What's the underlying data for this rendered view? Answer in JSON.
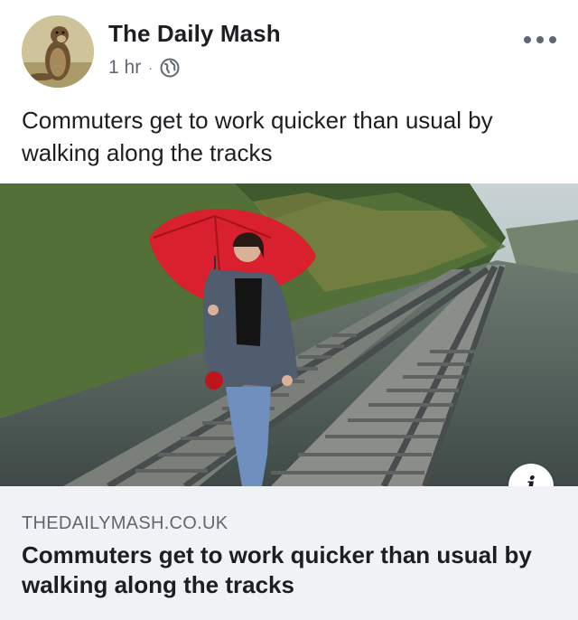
{
  "post": {
    "page_name": "The Daily Mash",
    "time": "1 hr",
    "separator": "·",
    "privacy_icon": "globe-icon",
    "menu_icon": "more-options-icon",
    "caption": "Commuters get to work quicker than usual by walking along the tracks"
  },
  "link_preview": {
    "image_alt": "Woman with red umbrella walking along railway tracks",
    "info_label": "i",
    "domain": "THEDAILYMASH.CO.UK",
    "title": "Commuters get to work quicker than usual by walking along the tracks"
  },
  "colors": {
    "text_primary": "#1c1e21",
    "text_secondary": "#606770",
    "link_bg": "#f0f2f5",
    "umbrella_red": "#d8202e"
  }
}
